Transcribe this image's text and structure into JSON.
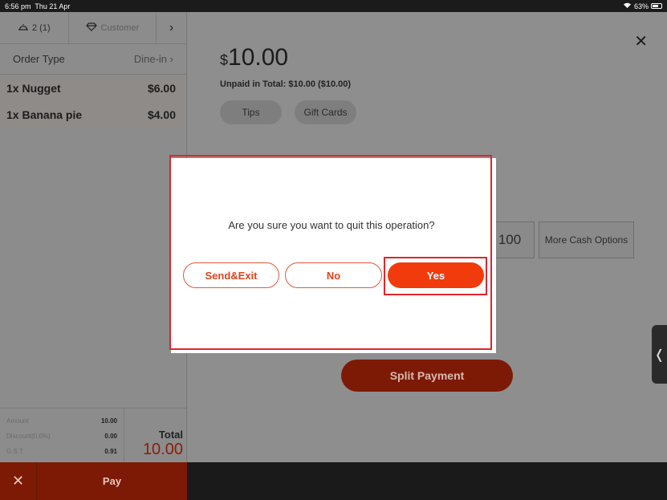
{
  "status_bar": {
    "time": "6:56 pm",
    "date": "Thu 21 Apr",
    "battery": "63%"
  },
  "order_panel": {
    "guests": "2 (1)",
    "customer": "Customer",
    "order_type_label": "Order Type",
    "order_type_value": "Dine-in",
    "items": [
      {
        "name": "1x Nugget",
        "price": "$6.00"
      },
      {
        "name": "1x Banana pie",
        "price": "$4.00"
      }
    ],
    "totals": {
      "amount_label": "Amount",
      "amount_value": "10.00",
      "discount_label": "Discount(0.0%)",
      "discount_value": "0.00",
      "gst_label": "G.S.T.",
      "gst_value": "0.91",
      "total_label": "Total",
      "total_value": "10.00"
    },
    "cancel_icon": "✕",
    "pay_label": "Pay"
  },
  "payment_panel": {
    "currency": "$",
    "amount": "10.00",
    "unpaid_text": "Unpaid in Total: $10.00 ($10.00)",
    "tips_label": "Tips",
    "gift_cards_label": "Gift Cards",
    "cash_100_label": "100",
    "more_cash_label": "More Cash Options",
    "split_payment_label": "Split Payment",
    "close_icon": "✕",
    "side_handle_icon": "❬"
  },
  "dialog": {
    "message": "Are you sure you want to quit this operation?",
    "send_exit_label": "Send&Exit",
    "no_label": "No",
    "yes_label": "Yes"
  },
  "colors": {
    "accent": "#f23b0c",
    "highlight": "#e0262b"
  }
}
